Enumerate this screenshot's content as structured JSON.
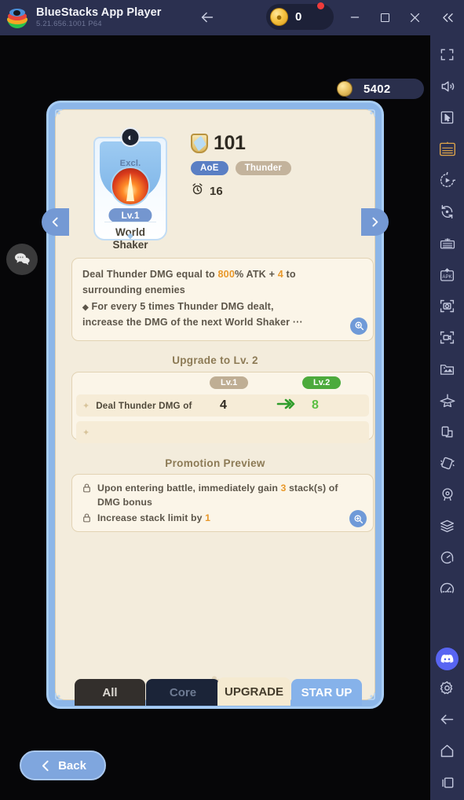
{
  "titlebar": {
    "app_name": "BlueStacks App Player",
    "version": "5.21.656.1001  P64",
    "back_icon": "arrow-left-icon",
    "logo_icon": "bluestacks-logo-icon",
    "coin_count": "0",
    "coin_icon": "coin-icon",
    "notification_dot": "notification-badge",
    "minimize_label": "—",
    "maximize_icon": "maximize-icon",
    "close_icon": "close-icon",
    "collapse_icon": "chevron-double-left-icon"
  },
  "game": {
    "gold": {
      "value": "5402",
      "icon": "gold-coin-icon"
    },
    "chat_icon": "chat-bubble-icon",
    "nav": {
      "prev_icon": "chevron-left-icon",
      "next_icon": "chevron-right-icon"
    },
    "skill": {
      "exclusive_label": "Excl.",
      "crest_icon": "crest-icon",
      "level_chip": "Lv.1",
      "name_line1": "World",
      "name_line2": "Shaker",
      "power_value": "101",
      "power_icon": "shield-icon",
      "tags": [
        {
          "label": "AoE",
          "type": "aoe"
        },
        {
          "label": "Thunder",
          "type": "element"
        }
      ],
      "cooldown_icon": "alarm-clock-icon",
      "cooldown_value": "16"
    },
    "description": {
      "line1_a": "Deal Thunder DMG equal to ",
      "line1_hl1": "800",
      "line1_b": "% ATK + ",
      "line1_hl2": "4",
      "line1_c": " to",
      "line2": "surrounding enemies",
      "line3_bullet": "◆",
      "line3": " For every 5 times Thunder DMG dealt,",
      "line4": "increase the DMG of the next World Shaker",
      "line4_ellipsis": "···",
      "magnifier_icon": "magnifier-zoom-icon"
    },
    "upgrade": {
      "section_title": "Upgrade to Lv. 2",
      "col_current": "Lv.1",
      "col_next": "Lv.2",
      "rows": [
        {
          "bullet": "✦",
          "label": "Deal Thunder DMG of",
          "old_value": "4",
          "arrow": "⇢",
          "new_value": "8"
        },
        {
          "bullet": "✦",
          "label": "",
          "old_value": "",
          "arrow": "",
          "new_value": ""
        }
      ]
    },
    "promotion": {
      "section_title": "Promotion Preview",
      "items": [
        {
          "icon": "lock-icon",
          "text_a": "Upon entering battle, immediately gain ",
          "hl": "3",
          "text_b": " stack(s) of DMG bonus"
        },
        {
          "icon": "lock-icon",
          "text_a": "Increase stack limit by ",
          "hl": "1",
          "text_b": ""
        }
      ],
      "magnifier_icon": "magnifier-zoom-icon"
    },
    "tabs": [
      {
        "label": "All",
        "state": "active"
      },
      {
        "label": "Core",
        "state": "inactive"
      },
      {
        "label": "UPGRADE",
        "state": "selected"
      },
      {
        "label": "STAR UP",
        "state": "inactive"
      }
    ],
    "back_button": {
      "label": "Back",
      "icon": "back-chevron-icon"
    }
  },
  "toolbar": {
    "items": [
      {
        "name": "fullscreen-icon",
        "label": "Fullscreen"
      },
      {
        "name": "volume-icon",
        "label": "Volume"
      },
      {
        "name": "cursor-pointer-icon",
        "label": "Pointer"
      },
      {
        "name": "keyboard-controls-icon",
        "label": "Game Controls"
      },
      {
        "name": "macro-record-icon",
        "label": "Macro"
      },
      {
        "name": "rotate-icon",
        "label": "Rotate"
      },
      {
        "name": "multi-instance-icon",
        "label": "Multi-Instance"
      },
      {
        "name": "install-apk-icon",
        "label": "Install APK"
      },
      {
        "name": "screenshot-icon",
        "label": "Screenshot"
      },
      {
        "name": "record-screen-icon",
        "label": "Record Screen"
      },
      {
        "name": "media-manager-icon",
        "label": "Media Manager"
      },
      {
        "name": "eco-mode-icon",
        "label": "Eco Mode"
      },
      {
        "name": "copy-screen-icon",
        "label": "Copy"
      },
      {
        "name": "shake-icon",
        "label": "Shake"
      },
      {
        "name": "location-icon",
        "label": "Location"
      },
      {
        "name": "layers-icon",
        "label": "Layers"
      },
      {
        "name": "trim-memory-icon",
        "label": "Trim Memory"
      },
      {
        "name": "performance-icon",
        "label": "Performance"
      },
      {
        "name": "discord-icon",
        "label": "Discord"
      },
      {
        "name": "settings-gear-icon",
        "label": "Settings"
      },
      {
        "name": "back-arrow-icon",
        "label": "Back"
      },
      {
        "name": "home-icon",
        "label": "Home"
      },
      {
        "name": "recent-apps-icon",
        "label": "Recent Apps"
      }
    ]
  },
  "colors": {
    "titlebar_bg": "#2b3050",
    "panel_border": "#8cb6e8",
    "panel_bg": "#f3ecdc",
    "accent_gold": "#e8982a",
    "accent_green": "#4caa3c",
    "tag_aoe": "#5a7fc4",
    "tag_element": "#c3b39c",
    "discord": "#5865f2"
  }
}
